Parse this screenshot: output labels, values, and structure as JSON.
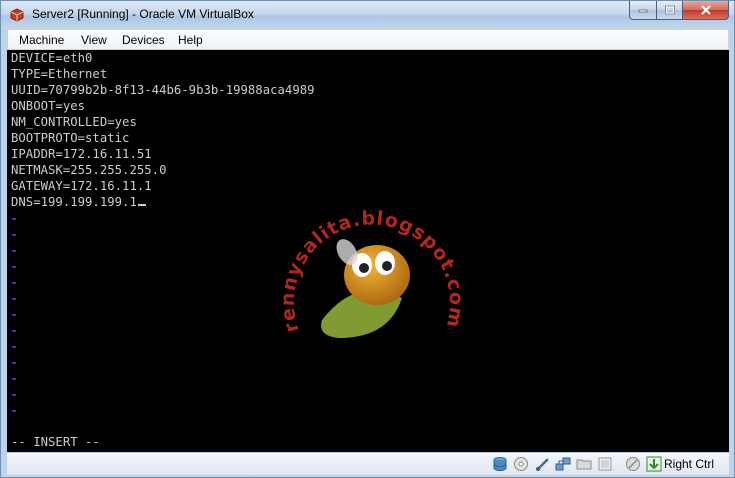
{
  "window": {
    "title": "Server2 [Running] - Oracle VM VirtualBox"
  },
  "menu": {
    "items": [
      "Machine",
      "View",
      "Devices",
      "Help"
    ]
  },
  "console": {
    "lines": [
      "DEVICE=eth0",
      "TYPE=Ethernet",
      "UUID=70799b2b-8f13-44b6-9b3b-19988aca4989",
      "ONBOOT=yes",
      "NM_CONTROLLED=yes",
      "BOOTPROTO=static",
      "IPADDR=172.16.11.51",
      "NETMASK=255.255.255.0",
      "GATEWAY=172.16.11.1",
      "DNS=199.199.199.1"
    ],
    "mode": "-- INSERT --",
    "watermark": "rennysalita.blogspot.com"
  },
  "status": {
    "host_key": "Right Ctrl",
    "icons": [
      "hard-disk-icon",
      "optical-drive-icon",
      "usb-icon",
      "network-icon",
      "shared-folders-icon",
      "display-icon",
      "mouse-integration-icon",
      "host-key-arrow-icon"
    ]
  },
  "colors": {
    "console_bg": "#000000",
    "console_text": "#cdcdcd",
    "tilde": "#2a3ea8",
    "close_button": "#c0392b"
  }
}
